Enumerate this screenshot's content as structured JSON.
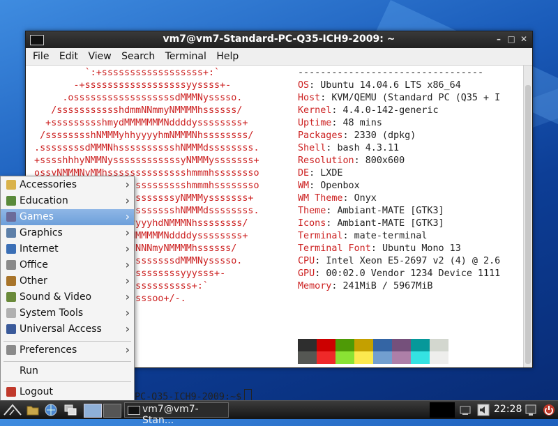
{
  "window": {
    "title": "vm7@vm7-Standard-PC-Q35-ICH9-2009: ~",
    "controls": {
      "minimize": "–",
      "maximize": "□",
      "close": "✕"
    }
  },
  "menubar": [
    "File",
    "Edit",
    "View",
    "Search",
    "Terminal",
    "Help"
  ],
  "logo_lines": [
    "          `:+ssssssssssssssssss+:`",
    "        -+ssssssssssssssssssyyssss+-",
    "      .ossssssssssssssssssdMMMNysssso.",
    "    /ssssssssssshdmmNNmmyNMMMMhssssss/",
    "   +ssssssssshmydMMMMMMMNddddyssssssss+",
    "  /sssssssshNMMMyhhyyyyhmNMMMNhssssssss/",
    " .ssssssssdMMMNhsssssssssshNMMMdssssssss.",
    " +sssshhhyNMMNyssssssssssssyNMMMysssssss+",
    " ossyNMMMNyMMhsssssssssssssshmmmhssssssso",
    "                 ssssssssssshmmmhssssssso",
    "                 sssssssssyNMMMysssssss+",
    "                 ssssssssshNMMMdssssssss.",
    "                 hyyyyhdNMMMNhssssssss/",
    "                 MMMMMMMNddddyssssssss+",
    "                 mNNNNmyNMMMMhssssss/",
    "                 sssssssssdMMMNysssso.",
    "                 ssssssssssyyysss+-",
    "                 ssssssssssss+:`",
    "                 ossssoo+/-."
  ],
  "info": {
    "separator": "---------------------------------",
    "rows": [
      {
        "label": "OS",
        "value": "Ubuntu 14.04.6 LTS x86_64"
      },
      {
        "label": "Host",
        "value": "KVM/QEMU (Standard PC (Q35 + I"
      },
      {
        "label": "Kernel",
        "value": "4.4.0-142-generic"
      },
      {
        "label": "Uptime",
        "value": "48 mins"
      },
      {
        "label": "Packages",
        "value": "2330 (dpkg)"
      },
      {
        "label": "Shell",
        "value": "bash 4.3.11"
      },
      {
        "label": "Resolution",
        "value": "800x600"
      },
      {
        "label": "DE",
        "value": "LXDE"
      },
      {
        "label": "WM",
        "value": "Openbox"
      },
      {
        "label": "WM Theme",
        "value": "Onyx"
      },
      {
        "label": "Theme",
        "value": "Ambiant-MATE [GTK3]"
      },
      {
        "label": "Icons",
        "value": "Ambiant-MATE [GTK3]"
      },
      {
        "label": "Terminal",
        "value": "mate-terminal"
      },
      {
        "label": "Terminal Font",
        "value": "Ubuntu Mono 13"
      },
      {
        "label": "CPU",
        "value": "Intel Xeon E5-2697 v2 (4) @ 2.6"
      },
      {
        "label": "GPU",
        "value": "00:02.0 Vendor 1234 Device 1111"
      },
      {
        "label": "Memory",
        "value": "241MiB / 5967MiB"
      }
    ]
  },
  "palette": {
    "top": [
      "#2e2e2e",
      "#cc0000",
      "#4e9a06",
      "#c4a000",
      "#3465a4",
      "#75507b",
      "#06989a",
      "#d3d7cf"
    ],
    "bottom": [
      "#555753",
      "#ef2929",
      "#8ae234",
      "#fce94f",
      "#729fcf",
      "#ad7fa8",
      "#34e2e2",
      "#eeeeec"
    ]
  },
  "prompt": "PC-Q35-ICH9-2009:~$",
  "app_menu": {
    "items": [
      {
        "label": "Accessories",
        "icon": "accessories-icon",
        "color": "#d9b24a",
        "submenu": true
      },
      {
        "label": "Education",
        "icon": "education-icon",
        "color": "#5a8a3a",
        "submenu": true
      },
      {
        "label": "Games",
        "icon": "games-icon",
        "color": "#6b6b9a",
        "submenu": true,
        "selected": true
      },
      {
        "label": "Graphics",
        "icon": "graphics-icon",
        "color": "#5d7fa8",
        "submenu": true
      },
      {
        "label": "Internet",
        "icon": "internet-icon",
        "color": "#3b6fb6",
        "submenu": true
      },
      {
        "label": "Office",
        "icon": "office-icon",
        "color": "#8a8a8a",
        "submenu": true
      },
      {
        "label": "Other",
        "icon": "other-icon",
        "color": "#a8742a",
        "submenu": true
      },
      {
        "label": "Sound & Video",
        "icon": "sound-video-icon",
        "color": "#6a8a3a",
        "submenu": true
      },
      {
        "label": "System Tools",
        "icon": "system-tools-icon",
        "color": "#b0b0b0",
        "submenu": true
      },
      {
        "label": "Universal Access",
        "icon": "universal-access-icon",
        "color": "#3a5a9a",
        "submenu": true
      }
    ],
    "preferences": "Preferences",
    "run": "Run",
    "logout": "Logout"
  },
  "taskbar": {
    "task_label": "vm7@vm7-Stan...",
    "clock": "22:28"
  }
}
